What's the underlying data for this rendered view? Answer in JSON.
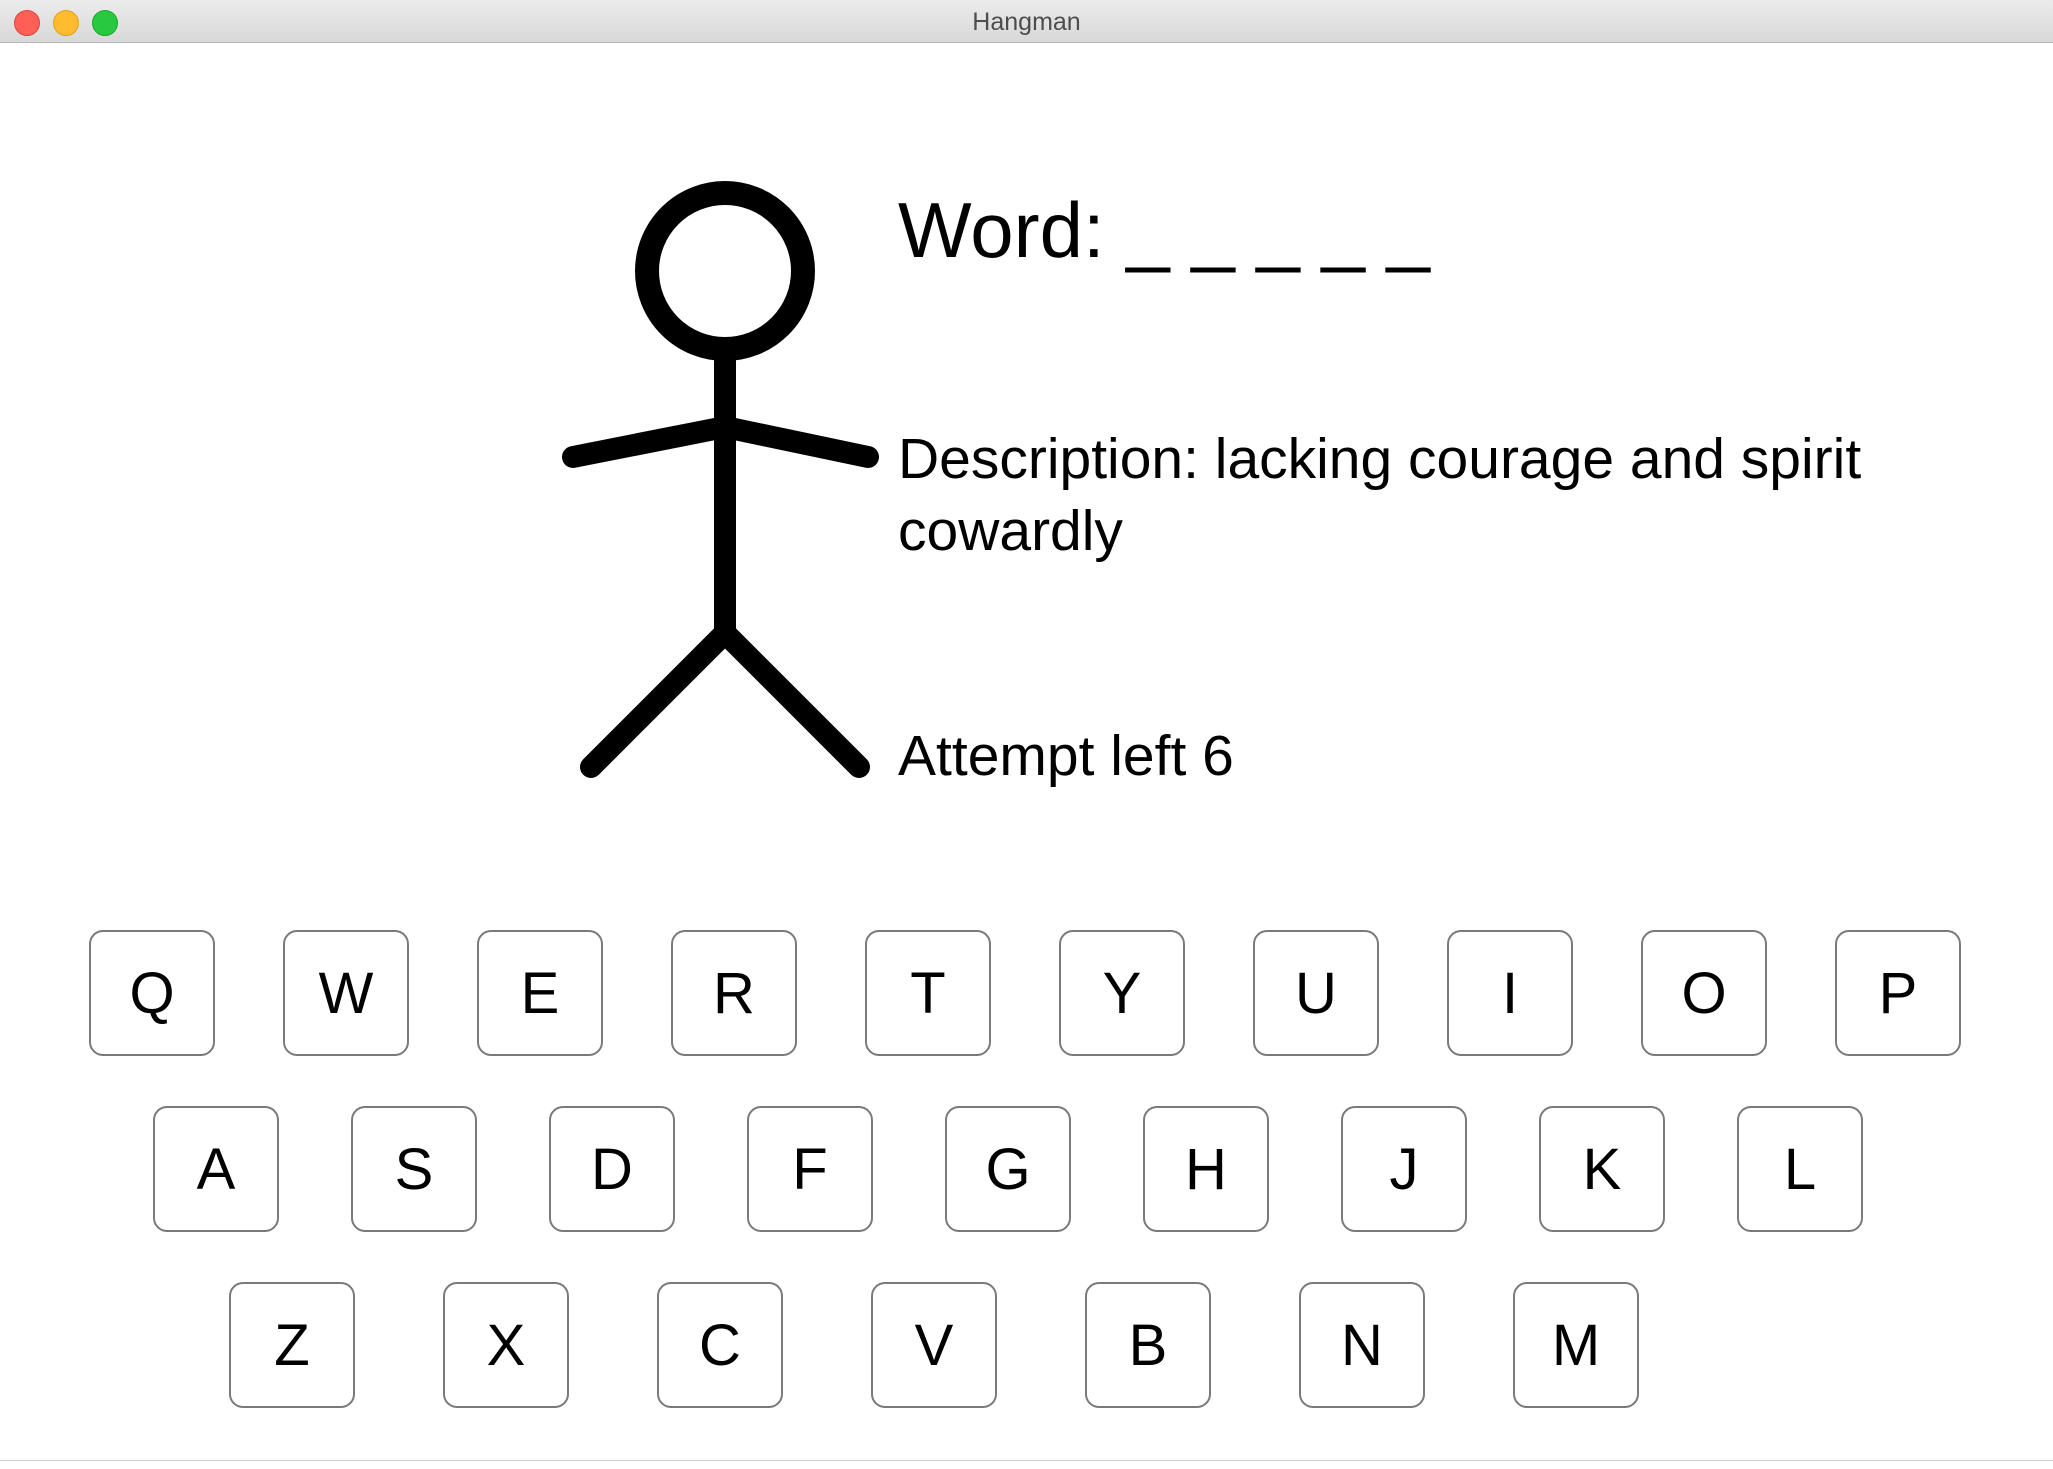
{
  "window": {
    "title": "Hangman"
  },
  "game": {
    "word_text": "Word: _ _ _ _ _",
    "description_text": "Description: lacking courage and spirit cowardly",
    "attempts_text": "Attempt left 6"
  },
  "keyboard": {
    "row1": [
      "Q",
      "W",
      "E",
      "R",
      "T",
      "Y",
      "U",
      "I",
      "O",
      "P"
    ],
    "row2": [
      "A",
      "S",
      "D",
      "F",
      "G",
      "H",
      "J",
      "K",
      "L"
    ],
    "row3": [
      "Z",
      "X",
      "C",
      "V",
      "B",
      "N",
      "M"
    ]
  },
  "colors": {
    "close": "#fe5f57",
    "minimize": "#febc2e",
    "maximize": "#28c840",
    "key_border": "#7a7a7a",
    "figure_stroke": "#000000"
  }
}
